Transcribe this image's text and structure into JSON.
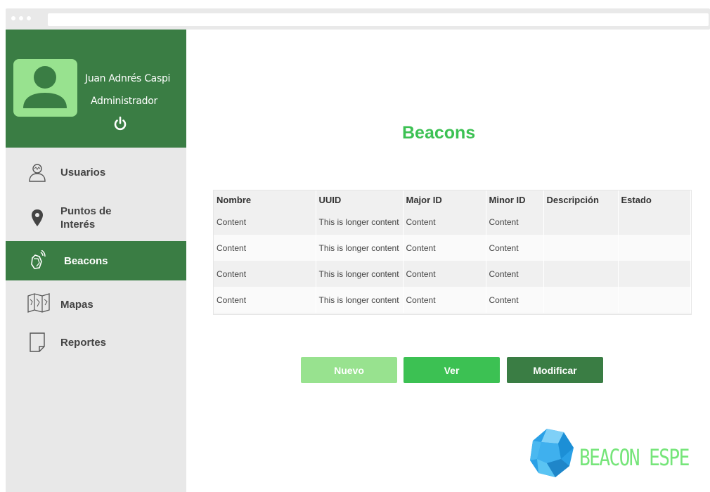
{
  "user": {
    "name": "Juan Adnrés Caspi",
    "role": "Administrador"
  },
  "nav": {
    "items": [
      {
        "label": "Usuarios",
        "icon": "user-icon",
        "active": false
      },
      {
        "label": "Puntos de\nInterés",
        "icon": "location-pin-icon",
        "active": false
      },
      {
        "label": "Beacons",
        "icon": "beacon-icon",
        "active": true
      },
      {
        "label": "Mapas",
        "icon": "map-icon",
        "active": false
      },
      {
        "label": "Reportes",
        "icon": "document-icon",
        "active": false
      }
    ]
  },
  "page": {
    "title": "Beacons"
  },
  "table": {
    "headers": [
      "Nombre",
      "UUID",
      "Major ID",
      "Minor ID",
      "Descripción",
      "Estado"
    ],
    "rows": [
      [
        "Content",
        "This is longer content",
        "Content",
        "Content",
        "",
        ""
      ],
      [
        "Content",
        "This is longer content",
        "Content",
        "Content",
        "",
        ""
      ],
      [
        "Content",
        "This is longer content",
        "Content",
        "Content",
        "",
        ""
      ],
      [
        "Content",
        "This is longer content",
        "Content",
        "Content",
        "",
        ""
      ]
    ]
  },
  "actions": {
    "new_label": "Nuevo",
    "view_label": "Ver",
    "edit_label": "Modificar"
  },
  "brand": {
    "name": "BEACON ESPE"
  },
  "colors": {
    "dark_green": "#3a7d44",
    "green": "#3cc153",
    "light_green": "#98e28f",
    "sidebar_bg": "#e8e8e8"
  }
}
